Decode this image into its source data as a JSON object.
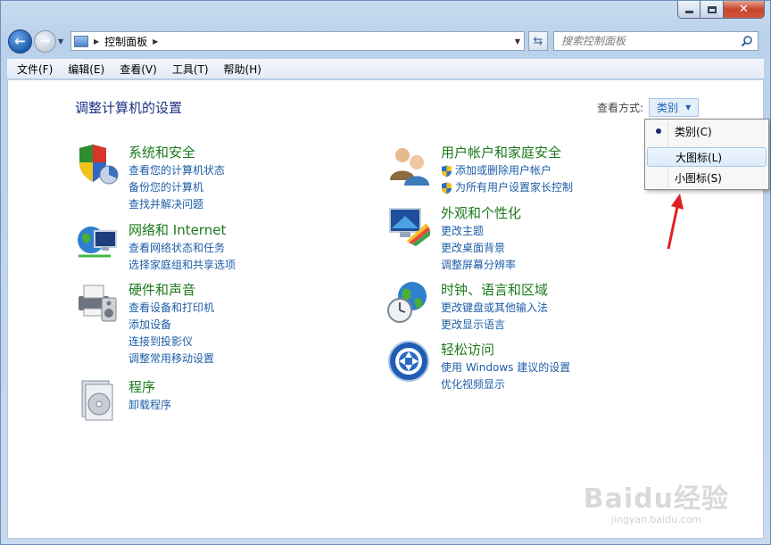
{
  "window": {
    "caption": {
      "minimize": "",
      "maximize": "",
      "close": "✕"
    }
  },
  "address": {
    "root_label": "",
    "current": "控制面板",
    "search_placeholder": "搜索控制面板"
  },
  "menu": {
    "items": [
      "文件(F)",
      "编辑(E)",
      "查看(V)",
      "工具(T)",
      "帮助(H)"
    ]
  },
  "page": {
    "title": "调整计算机的设置",
    "view_by_label": "查看方式:",
    "view_by_value": "类别"
  },
  "view_dropdown": {
    "items": [
      {
        "label": "类别(C)",
        "selected": true
      },
      {
        "label": "大图标(L)",
        "hovered": true
      },
      {
        "label": "小图标(S)"
      }
    ]
  },
  "categories": [
    {
      "title": "系统和安全",
      "icon": "security-shield-icon",
      "links": [
        "查看您的计算机状态",
        "备份您的计算机",
        "查找并解决问题"
      ]
    },
    {
      "title": "网络和 Internet",
      "icon": "network-globe-icon",
      "links": [
        "查看网络状态和任务",
        "选择家庭组和共享选项"
      ]
    },
    {
      "title": "硬件和声音",
      "icon": "printer-speaker-icon",
      "links": [
        "查看设备和打印机",
        "添加设备",
        "连接到投影仪",
        "调整常用移动设置"
      ]
    },
    {
      "title": "程序",
      "icon": "programs-disc-icon",
      "links": [
        "卸载程序"
      ]
    },
    {
      "title": "用户帐户和家庭安全",
      "icon": "users-icon",
      "links": [
        "添加或删除用户帐户",
        "为所有用户设置家长控制"
      ]
    },
    {
      "title": "外观和个性化",
      "icon": "monitor-palette-icon",
      "links": [
        "更改主题",
        "更改桌面背景",
        "调整屏幕分辨率"
      ]
    },
    {
      "title": "时钟、语言和区域",
      "icon": "globe-clock-icon",
      "links": [
        "更改键盘或其他输入法",
        "更改显示语言"
      ]
    },
    {
      "title": "轻松访问",
      "icon": "ease-of-access-icon",
      "links": [
        "使用 Windows 建议的设置",
        "优化视频显示"
      ]
    }
  ],
  "watermark": {
    "logo": "Baidu经验",
    "url": "jingyan.baidu.com"
  },
  "colors": {
    "category_title": "#1c7a1c",
    "link": "#1e5ea8",
    "page_title": "#1e3287",
    "annotation_arrow": "#e02020"
  }
}
